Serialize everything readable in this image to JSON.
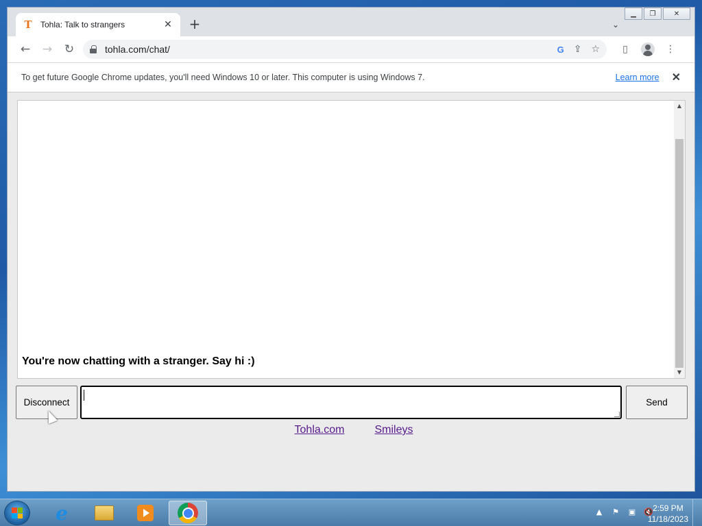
{
  "browser": {
    "tab_title": "Tohla: Talk to strangers",
    "tab_favicon": "T",
    "tab_close": "✕",
    "new_tab": "+",
    "tab_search": "⌄",
    "back": "←",
    "forward": "→",
    "reload": "↻",
    "url": "tohla.com/chat/",
    "google_icon": "G",
    "share_icon": "⇪",
    "bookmark_icon": "☆",
    "side_panel_icon": "▯",
    "menu_icon": "⋮",
    "window_minimize": "▁",
    "window_restore": "❐",
    "window_close": "✕"
  },
  "infobar": {
    "message": "To get future Google Chrome updates, you'll need Windows 10 or later. This computer is using Windows 7.",
    "link": "Learn more",
    "close": "✕"
  },
  "chat": {
    "status_message": "You're now chatting with a stranger. Say hi :)",
    "disconnect_label": "Disconnect",
    "send_label": "Send",
    "input_value": "",
    "scroll_up": "▲",
    "scroll_down": "▼"
  },
  "footer_links": [
    {
      "label": "Tohla.com"
    },
    {
      "label": "Smileys"
    }
  ],
  "taskbar": {
    "ie_glyph": "e",
    "tray_arrow": "▲",
    "tray_flag": "⚑",
    "tray_network": "▣",
    "tray_volume": "🔇",
    "time": "2:59 PM",
    "date": "11/18/2023"
  }
}
